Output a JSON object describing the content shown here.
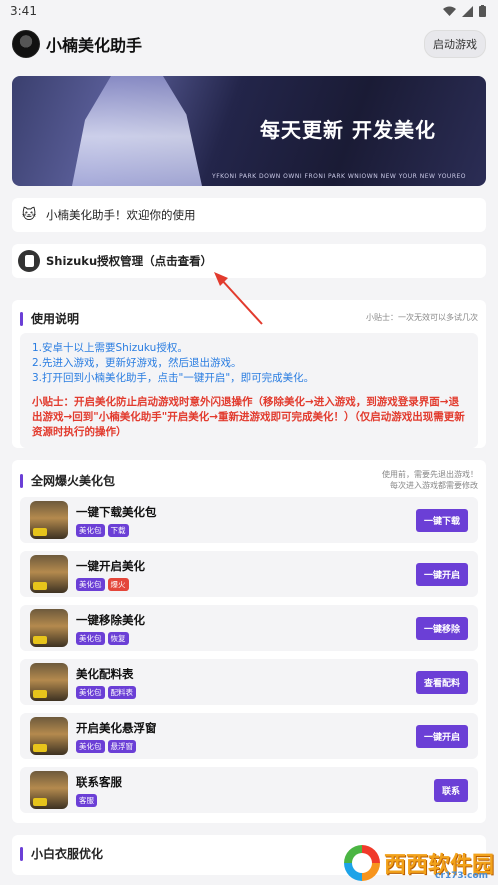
{
  "status": {
    "time": "3:41"
  },
  "appbar": {
    "title": "小楠美化助手",
    "launch_label": "启动游戏"
  },
  "banner": {
    "headline": "每天更新 开发美化",
    "small_text": "YFKONI PARK DOWN OWNI FRONI PARK WNIOWN NEW YOUR NEW YOUREO"
  },
  "welcome": {
    "text": "小楠美化助手！欢迎你的使用"
  },
  "shizuku": {
    "text": "Shizuku授权管理（点击查看）"
  },
  "instructions": {
    "title": "使用说明",
    "tip": "小贴士：一次无效可以多试几次",
    "steps": [
      "1.安卓十以上需要Shizuku授权。",
      "2.先进入游戏，更新好游戏，然后退出游戏。",
      "3.打开回到小楠美化助手，点击\"一键开启\"，即可完成美化。"
    ],
    "warning": "小贴士：开启美化防止启动游戏时意外闪退操作（移除美化→进入游戏，到游戏登录界面→退出游戏→回到\"小楠美化助手\"开启美化→重新进游戏即可完成美化！）（仅启动游戏出现需更新资源时执行的操作）"
  },
  "packs": {
    "title": "全网爆火美化包",
    "tip_line1": "使用前，需要先退出游戏！",
    "tip_line2": "每次进入游戏都需要修改",
    "items": [
      {
        "title": "一键下载美化包",
        "tags": [
          "美化包",
          "下载"
        ],
        "tag_colors": [
          "purple",
          "purple"
        ],
        "button": "一键下载"
      },
      {
        "title": "一键开启美化",
        "tags": [
          "美化包",
          "爆火"
        ],
        "tag_colors": [
          "purple",
          "red"
        ],
        "button": "一键开启"
      },
      {
        "title": "一键移除美化",
        "tags": [
          "美化包",
          "恢复"
        ],
        "tag_colors": [
          "purple",
          "purple"
        ],
        "button": "一键移除"
      },
      {
        "title": "美化配料表",
        "tags": [
          "美化包",
          "配料表"
        ],
        "tag_colors": [
          "purple",
          "purple"
        ],
        "button": "查看配料"
      },
      {
        "title": "开启美化悬浮窗",
        "tags": [
          "美化包",
          "悬浮窗"
        ],
        "tag_colors": [
          "purple",
          "purple"
        ],
        "button": "一键开启"
      },
      {
        "title": "联系客服",
        "tags": [
          "客服"
        ],
        "tag_colors": [
          "purple"
        ],
        "button": "联系"
      }
    ]
  },
  "next_section": {
    "title": "小白衣服优化"
  },
  "watermark": {
    "text": "西西软件园",
    "sub": "cr173.com"
  },
  "colors": {
    "accent": "#6b3fd6",
    "warn_red": "#e23b2e",
    "info_blue": "#2a7de1"
  }
}
